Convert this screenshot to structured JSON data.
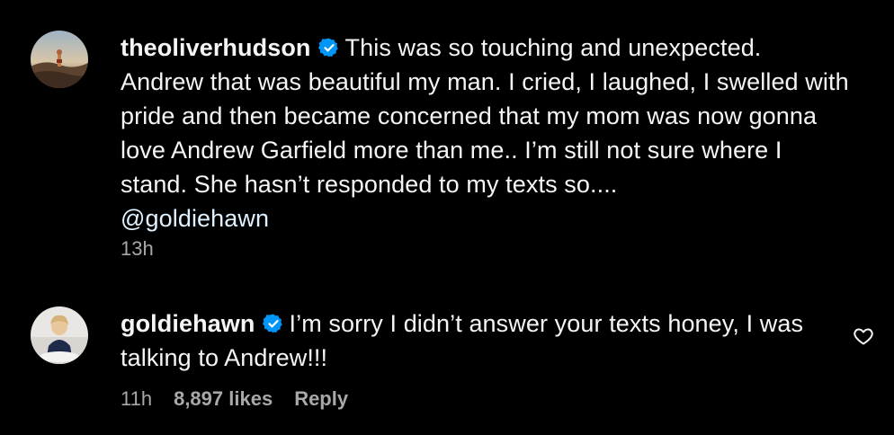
{
  "comments": [
    {
      "username": "theoliverhudson",
      "verified": true,
      "text": "This was so touching and unexpected. Andrew that was beautiful my man. I cried, I laughed, I swelled with pride and then became concerned that my mom was now gonna love Andrew Garfield more than me.. I’m still not sure where I stand. She hasn’t responded to my texts so....",
      "mention": "@goldiehawn",
      "time": "13h"
    },
    {
      "username": "goldiehawn",
      "verified": true,
      "text": "I’m sorry I didn’t answer your texts honey, I was talking to Andrew!!!",
      "time": "11h",
      "likes": "8,897 likes",
      "reply_label": "Reply",
      "like_icon": "heart-outline-icon"
    }
  ],
  "colors": {
    "background": "#000000",
    "text": "#f5f5f5",
    "meta": "#a8a8a8",
    "mention": "#e0f1ff",
    "verified_badge": "#0095f6"
  }
}
